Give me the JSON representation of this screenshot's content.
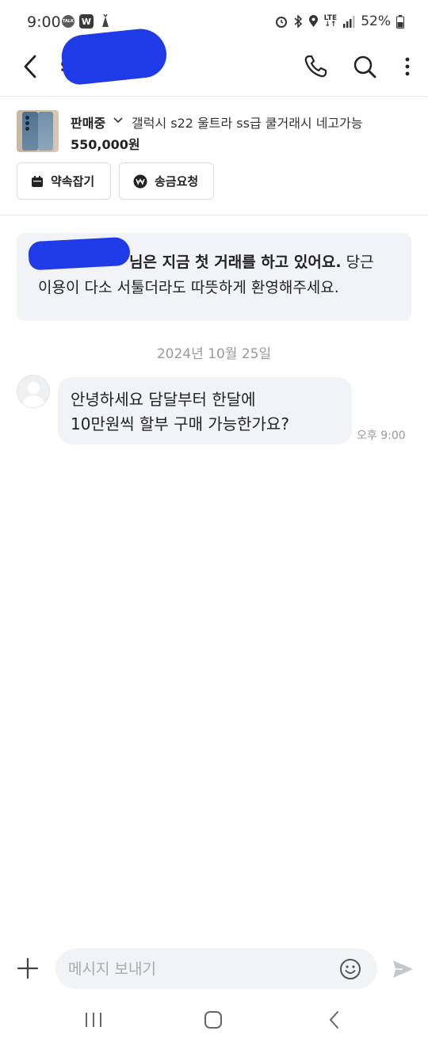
{
  "status_bar": {
    "time": "9:00",
    "talk_badge": "TALK",
    "w_badge": "W",
    "network": "LTE",
    "battery": "52%",
    "icons": [
      "talk-icon",
      "w-icon",
      "carrot-icon",
      "alarm-icon",
      "bluetooth-icon",
      "location-icon",
      "lte-icon",
      "signal-icon",
      "battery-icon"
    ]
  },
  "header": {
    "name": "s",
    "icons": [
      "back-icon",
      "phone-icon",
      "search-icon",
      "more-icon"
    ]
  },
  "product": {
    "status": "판매중",
    "title": "갤럭시 s22 울트라 ss급 쿨거래시 네고가능",
    "price": "550,000원"
  },
  "actions": {
    "appointment": "약속잡기",
    "transfer": "송금요청"
  },
  "notice": {
    "line1_prefix": "님은",
    "line1_bold": " 지금 첫 거래를 하고 있어요.",
    "line1_rest": " 당근",
    "line2": "이용이 다소 서툴더라도 따뜻하게 환영해주세요."
  },
  "chat": {
    "date": "2024년 10월 25일",
    "messages": [
      {
        "lines": [
          "안녕하세요 담달부터 한달에",
          "10만원씩 할부 구매 가능한가요?"
        ],
        "time": "오후 9:00"
      }
    ]
  },
  "input": {
    "placeholder": "메시지 보내기",
    "value": ""
  },
  "colors": {
    "redaction": "#1f3be8",
    "bubble": "#f2f3f6",
    "muted_text": "#999999"
  }
}
